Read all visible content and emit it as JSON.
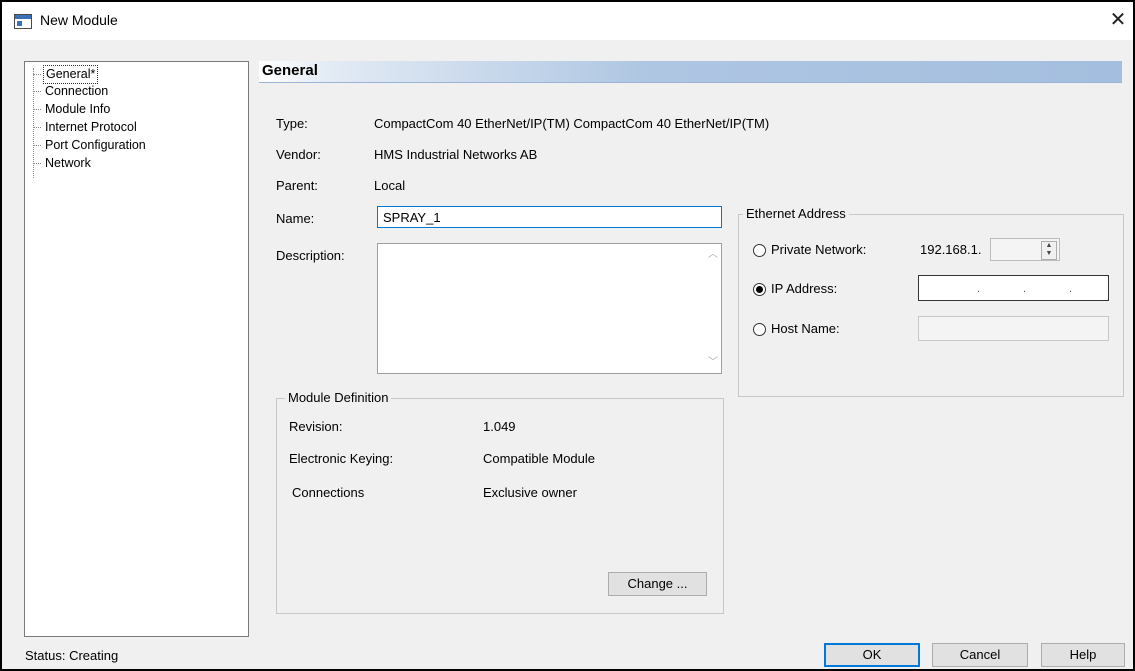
{
  "window": {
    "title": "New Module",
    "close_glyph": "✕"
  },
  "tree": {
    "items": [
      {
        "label": "General*",
        "selected": true
      },
      {
        "label": "Connection"
      },
      {
        "label": "Module Info"
      },
      {
        "label": "Internet Protocol"
      },
      {
        "label": "Port Configuration"
      },
      {
        "label": "Network"
      }
    ]
  },
  "general": {
    "header": "General",
    "type_label": "Type:",
    "type_value": "CompactCom 40 EtherNet/IP(TM) CompactCom 40 EtherNet/IP(TM)",
    "vendor_label": "Vendor:",
    "vendor_value": "HMS Industrial Networks AB",
    "parent_label": "Parent:",
    "parent_value": "Local",
    "name_label": "Name:",
    "name_value": "SPRAY_1",
    "description_label": "Description:",
    "description_value": ""
  },
  "module_definition": {
    "title": "Module Definition",
    "revision_label": "Revision:",
    "revision_value": "1.049",
    "keying_label": "Electronic Keying:",
    "keying_value": "Compatible Module",
    "connections_label": "Connections",
    "connections_value": "Exclusive owner",
    "change_button": "Change ..."
  },
  "ethernet": {
    "title": "Ethernet Address",
    "private_label": "Private Network:",
    "private_prefix": "192.168.1.",
    "private_octet": "",
    "ip_label": "IP Address:",
    "host_label": "Host Name:",
    "host_value": "",
    "selected": "ip"
  },
  "footer": {
    "status": "Status: Creating",
    "ok": "OK",
    "cancel": "Cancel",
    "help": "Help"
  },
  "icons": {
    "close": "close-icon",
    "window": "window-icon",
    "scroll_up": "chevron-up-icon",
    "scroll_down": "chevron-down-icon",
    "spin": "spin-up-down-icon"
  }
}
